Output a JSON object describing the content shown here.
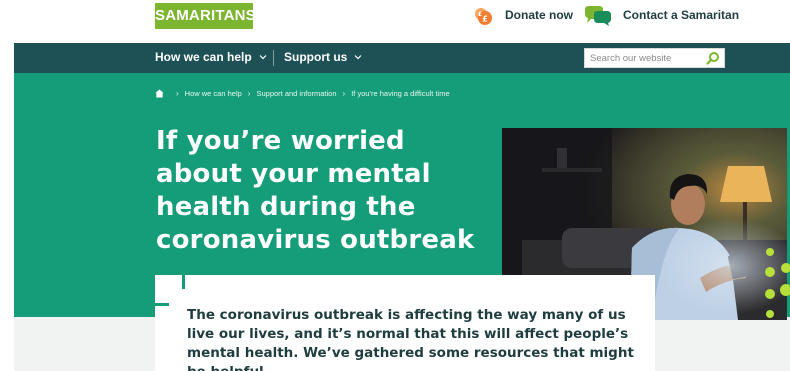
{
  "header": {
    "logo_text": "SAMARITANS",
    "donate_label": "Donate now",
    "donate_icon": "donate-coin-icon",
    "contact_label": "Contact a Samaritan",
    "contact_icon": "chat-bubbles-icon"
  },
  "nav": {
    "items": [
      {
        "label": "How we can help"
      },
      {
        "label": "Support us"
      }
    ],
    "search": {
      "placeholder": "Search our website",
      "value": ""
    }
  },
  "breadcrumb": {
    "items": [
      "How we can help",
      "Support and information",
      "If you're having a difficult time"
    ]
  },
  "hero": {
    "title": "If you’re worried about your mental health during the coronavirus outbreak"
  },
  "intro": {
    "text": "The coronavirus outbreak is affecting the way many of us live our lives, and it’s normal that this will affect people’s mental health. We’ve gathered some resources that might be helpful."
  },
  "colors": {
    "brand_green": "#7cb52f",
    "nav_teal": "#1e5156",
    "hero_green": "#159d79",
    "text_dark": "#1f3d3f"
  }
}
